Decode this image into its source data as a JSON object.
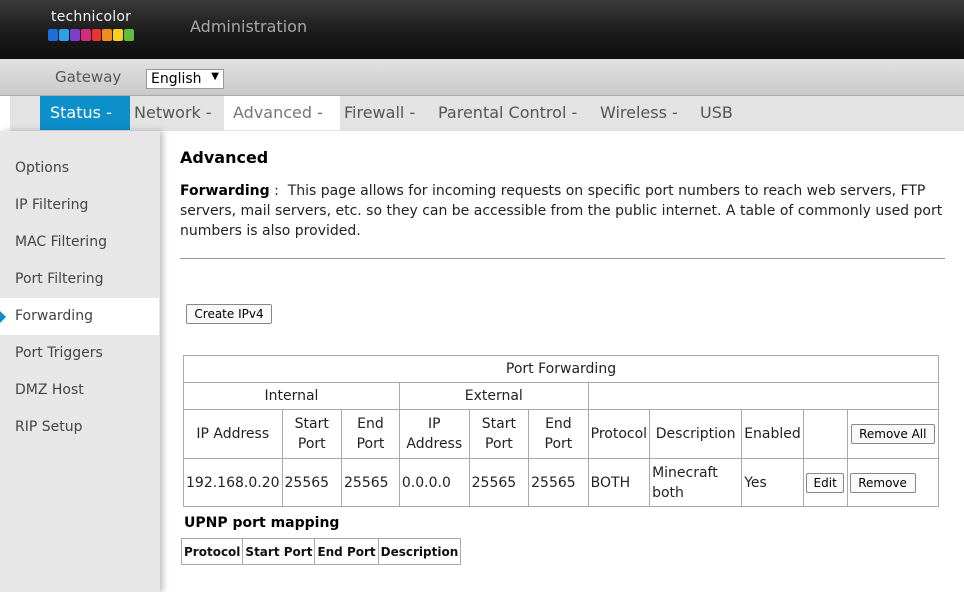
{
  "header": {
    "logo_text": "technicolor",
    "title": "Administration",
    "logo_colors": [
      "#1e6ed9",
      "#2aa0e6",
      "#7c3fc9",
      "#d62a7a",
      "#e8342d",
      "#f08c1a",
      "#f7d11b",
      "#5fbf3c"
    ]
  },
  "gateway_bar": {
    "label": "Gateway",
    "language": "English"
  },
  "nav": {
    "items": [
      {
        "label": "Status -"
      },
      {
        "label": "Network -"
      },
      {
        "label": "Advanced -"
      },
      {
        "label": "Firewall -"
      },
      {
        "label": "Parental Control -"
      },
      {
        "label": "Wireless -"
      },
      {
        "label": "USB"
      }
    ],
    "active_color": "#0d8fca"
  },
  "sidebar": {
    "items": [
      {
        "label": "Options"
      },
      {
        "label": "IP Filtering"
      },
      {
        "label": "MAC Filtering"
      },
      {
        "label": "Port Filtering"
      },
      {
        "label": "Forwarding"
      },
      {
        "label": "Port Triggers"
      },
      {
        "label": "DMZ Host"
      },
      {
        "label": "RIP Setup"
      }
    ],
    "selected": "Forwarding"
  },
  "main": {
    "title": "Advanced",
    "desc_label": "Forwarding",
    "desc_sep": " :  ",
    "desc_text": "This page allows for incoming requests on specific port numbers to reach web servers, FTP servers, mail servers, etc. so they can be accessible from the public internet. A table of commonly used port numbers is also provided.",
    "create_button": "Create IPv4"
  },
  "port_forwarding": {
    "title": "Port Forwarding",
    "group_internal": "Internal",
    "group_external": "External",
    "headers": {
      "ip_address": "IP Address",
      "start_port": "Start Port",
      "end_port": "End Port",
      "ext_ip_address": "IP Address",
      "ext_start_port": "Start Port",
      "ext_end_port": "End Port",
      "protocol": "Protocol",
      "description": "Description",
      "enabled": "Enabled"
    },
    "remove_all_button": "Remove All",
    "rows": [
      {
        "ip": "192.168.0.20",
        "start": "25565",
        "end": "25565",
        "ext_ip": "0.0.0.0",
        "ext_start": "25565",
        "ext_end": "25565",
        "protocol": "BOTH",
        "description": "Minecraft both",
        "enabled": "Yes",
        "edit_button": "Edit",
        "remove_button": "Remove"
      }
    ]
  },
  "upnp": {
    "title": "UPNP port mapping",
    "headers": [
      "Protocol",
      "Start Port",
      "End Port",
      "Description"
    ]
  }
}
